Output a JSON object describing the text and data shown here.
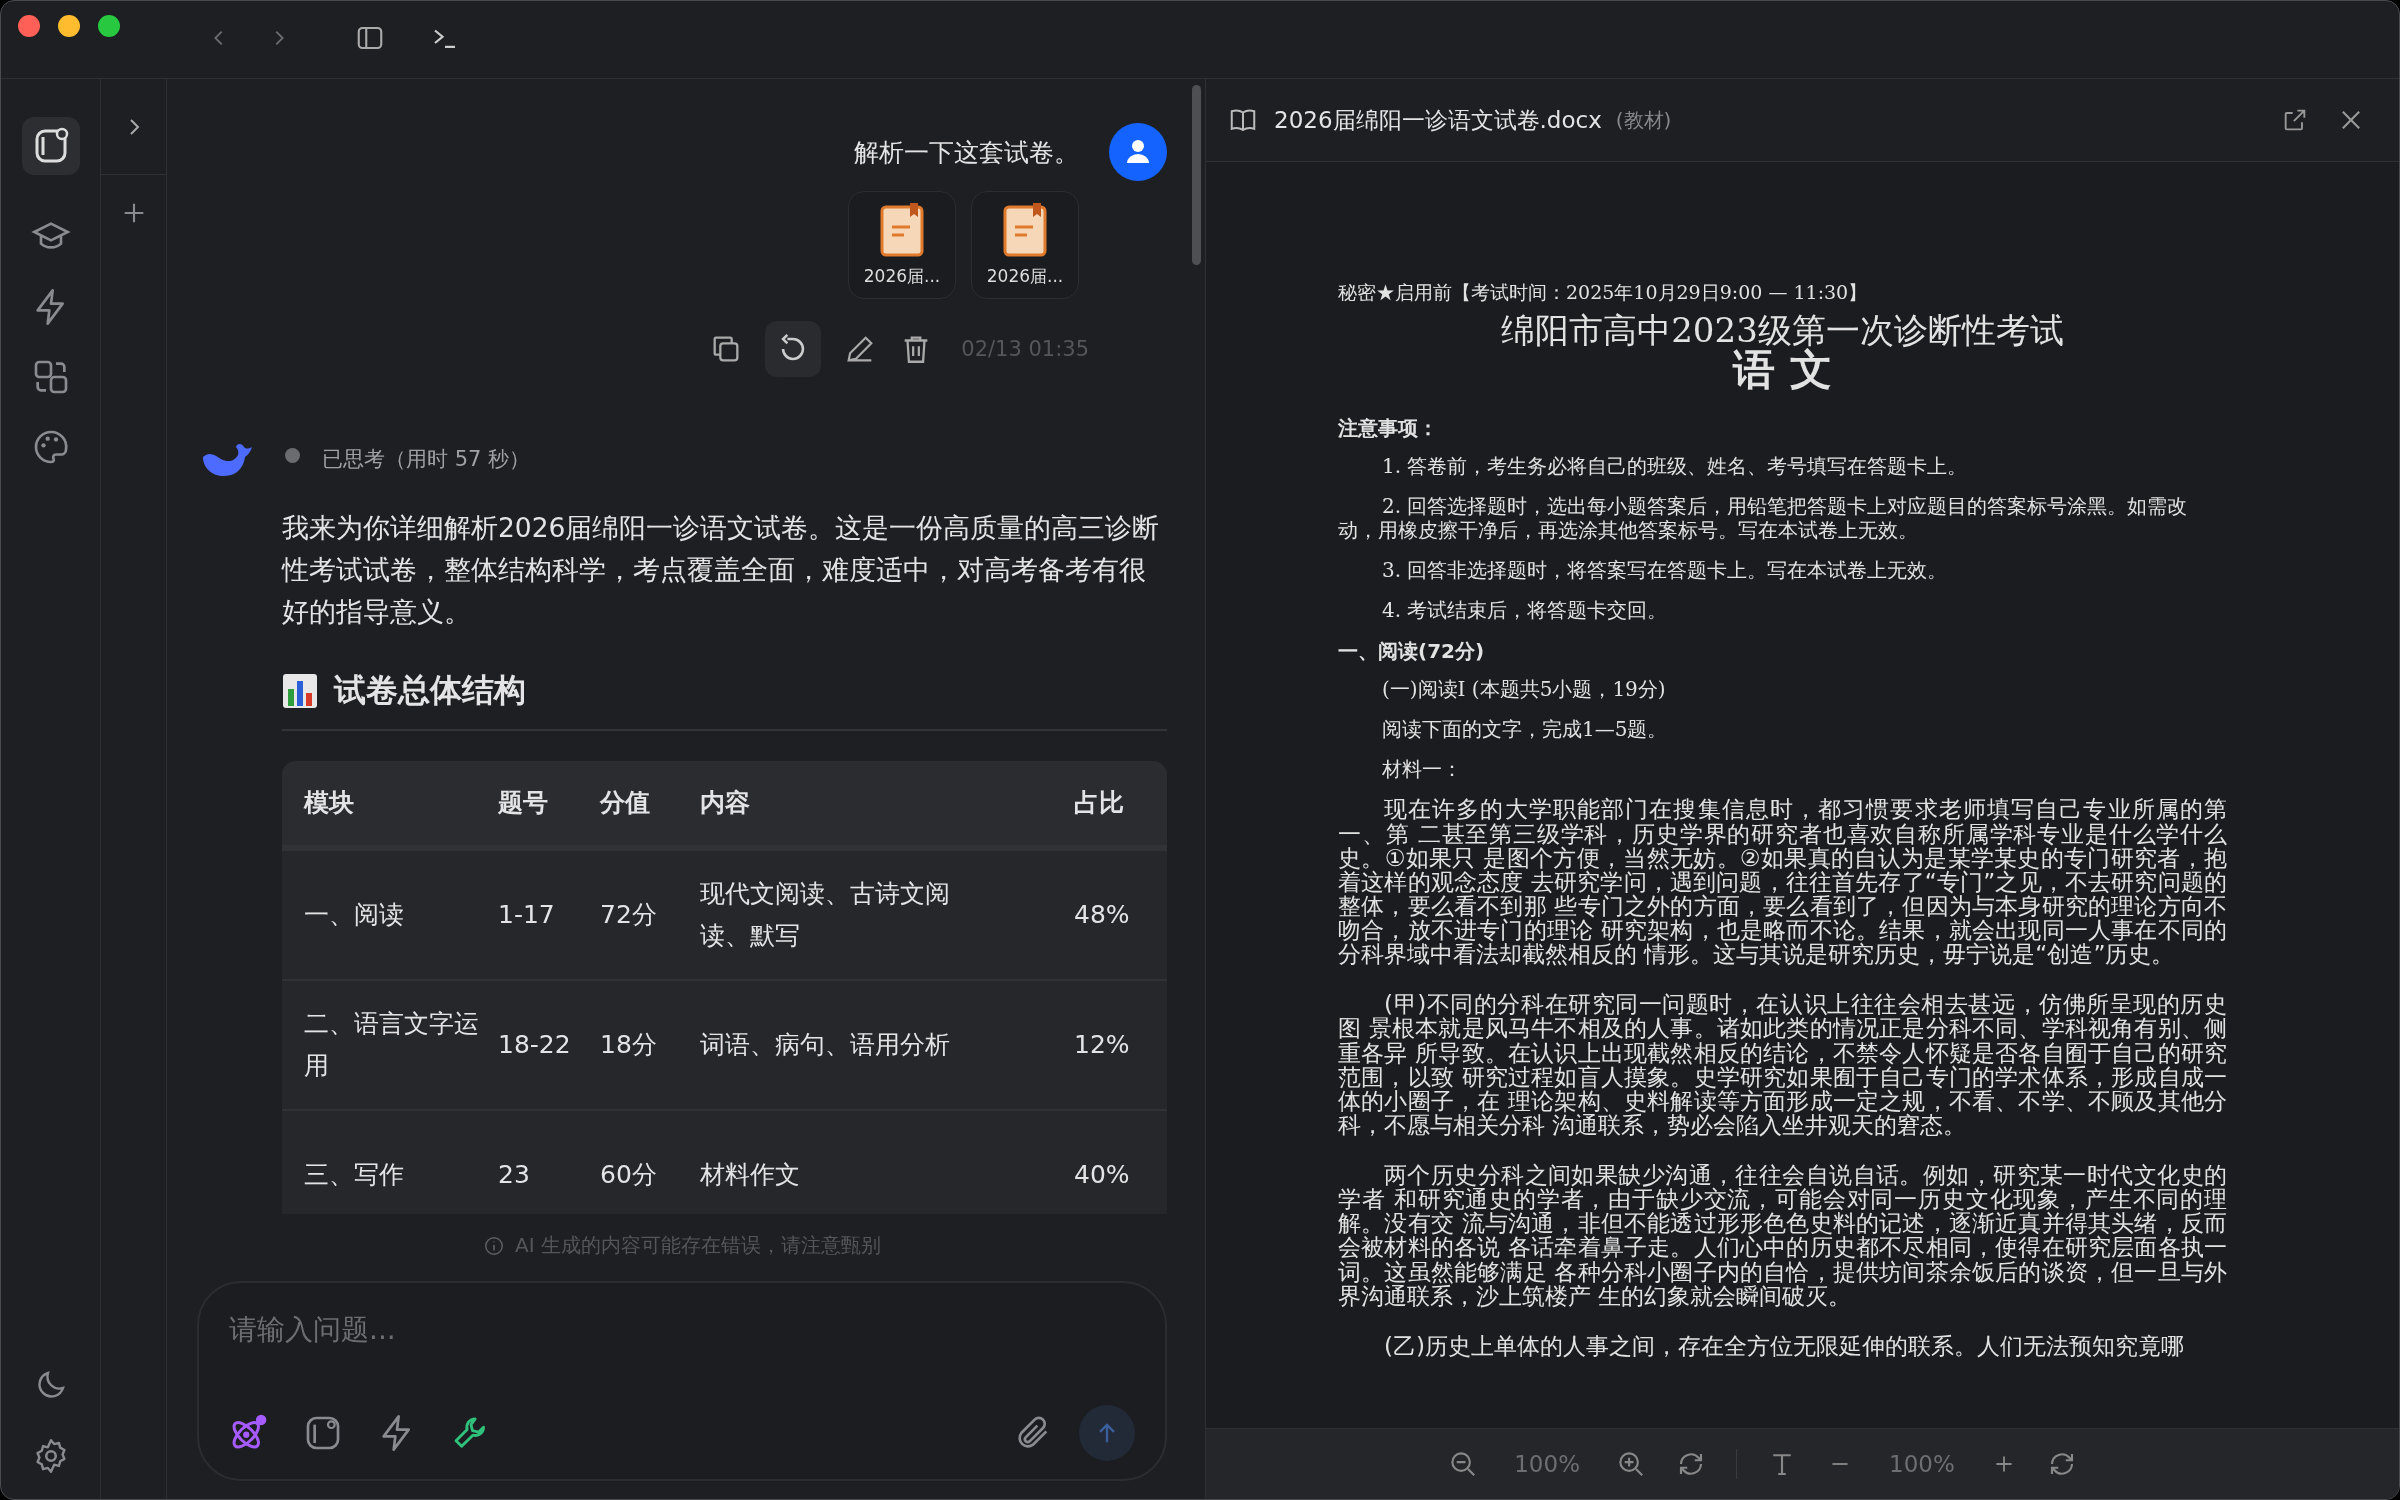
{
  "chat": {
    "user_message": {
      "text": "解析一下这套试卷。",
      "attachments": [
        {
          "name": "2026届..."
        },
        {
          "name": "2026届..."
        }
      ],
      "timestamp": "02/13 01:35"
    },
    "assistant": {
      "thinking": "已思考（用时 57 秒）",
      "paragraph": "我来为你详细解析2026届绵阳一诊语文试卷。这是一份高质量的高三诊断性考试试卷，整体结构科学，考点覆盖全面，难度适中，对高考备考有很好的指导意义。",
      "heading": "试卷总体结构",
      "table": {
        "columns": [
          "模块",
          "题号",
          "分值",
          "内容",
          "占比"
        ],
        "rows": [
          [
            "一、阅读",
            "1-17",
            "72分",
            "现代文阅读、古诗文阅读、默写",
            "48%"
          ],
          [
            "二、语言文字运用",
            "18-22",
            "18分",
            "词语、病句、语用分析",
            "12%"
          ],
          [
            "三、写作",
            "23",
            "60分",
            "材料作文",
            "40%"
          ]
        ]
      }
    },
    "disclaimer": "AI 生成的内容可能存在错误，请注意甄别",
    "input": {
      "placeholder": "请输入问题..."
    }
  },
  "document": {
    "title": "2026届绵阳一诊语文试卷.docx",
    "tag": "(教材)",
    "blocks": [
      {
        "kind": "meta",
        "text": "秘密★启用前【考试时间：2025年10月29日9:00 — 11:30】"
      },
      {
        "kind": "title",
        "text": "绵阳市高中2023级第一次诊断性考试"
      },
      {
        "kind": "subject",
        "text": "语 文"
      },
      {
        "kind": "section",
        "text": "注意事项："
      },
      {
        "kind": "item",
        "text": "1. 答卷前，考生务必将自己的班级、姓名、考号填写在答题卡上。"
      },
      {
        "kind": "item",
        "text": "2. 回答选择题时，选出每小题答案后，用铅笔把答题卡上对应题目的答案标号涂黑。如需改动，用橡皮擦干净后，再选涂其他答案标号。写在本试卷上无效。"
      },
      {
        "kind": "item",
        "text": "3. 回答非选择题时，将答案写在答题卡上。写在本试卷上无效。"
      },
      {
        "kind": "item",
        "text": "4. 考试结束后，将答题卡交回。"
      },
      {
        "kind": "section",
        "text": "一、阅读(72分)"
      },
      {
        "kind": "item",
        "text": "(一)阅读I (本题共5小题，19分)"
      },
      {
        "kind": "item",
        "text": "阅读下面的文字，完成1—5题。"
      },
      {
        "kind": "item",
        "text": "材料一："
      },
      {
        "kind": "para",
        "text": "现在许多的大学职能部门在搜集信息时，都习惯要求老师填写自己专业所属的第一、第 二甚至第三级学科，历史学界的研究者也喜欢自称所属学科专业是什么学什么史。①如果只 是图个方便，当然无妨。②如果真的自认为是某学某史的专门研究者，抱着这样的观念态度 去研究学问，遇到问题，往往首先存了“专门”之见，不去研究问题的整体，要么看不到那 些专门之外的方面，要么看到了，但因为与本身研究的理论方向不吻合，放不进专门的理论 研究架构，也是略而不论。结果，就会出现同一人事在不同的分科界域中看法却截然相反的 情形。这与其说是研究历史，毋宁说是“创造”历史。"
      },
      {
        "kind": "para",
        "text": "(甲)不同的分科在研究同一问题时，在认识上往往会相去甚远，仿佛所呈现的历史图 景根本就是风马牛不相及的人事。诸如此类的情况正是分科不同、学科视角有别、侧重各异 所导致。在认识上出现截然相反的结论，不禁令人怀疑是否各自囿于自己的研究范围，以致 研究过程如盲人摸象。史学研究如果囿于自己专门的学术体系，形成自成一体的小圈子，在 理论架构、史料解读等方面形成一定之规，不看、不学、不顾及其他分科，不愿与相关分科 沟通联系，势必会陷入坐井观天的窘态。"
      },
      {
        "kind": "para",
        "text": "两个历史分科之间如果缺少沟通，往往会自说自话。例如，研究某一时代文化史的学者 和研究通史的学者，由于缺少交流，可能会对同一历史文化现象，产生不同的理解。没有交 流与沟通，非但不能透过形形色色史料的记述，逐渐近真并得其头绪，反而会被材料的各说 各话牵着鼻子走。人们心中的历史都不尽相同，使得在研究层面各执一词。这虽然能够满足 各种分科小圈子内的自恰，提供坊间茶余饭后的谈资，但一旦与外界沟通联系，沙上筑楼产 生的幻象就会瞬间破灭。"
      },
      {
        "kind": "para",
        "text": "(乙)历史上单体的人事之间，存在全方位无限延伸的联系。人们无法预知究竟哪"
      }
    ],
    "toolbar": {
      "zoom": "100%",
      "font_size": "100%"
    }
  }
}
